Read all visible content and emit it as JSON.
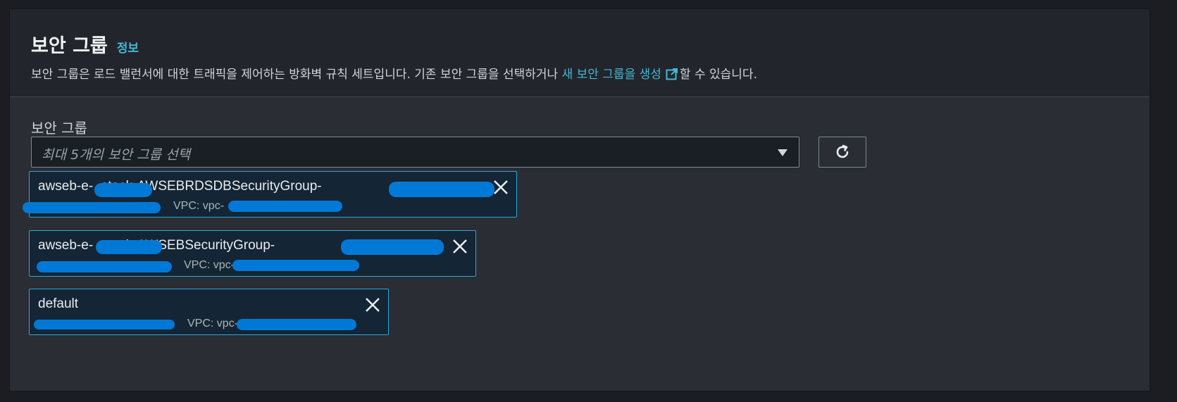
{
  "section": {
    "title": "보안 그룹",
    "info_link": "정보",
    "description_before": "보안 그룹은 로드 밸런서에 대한 트래픽을 제어하는 방화벽 규칙 세트입니다. 기존 보안 그룹을 선택하거나 ",
    "create_link": "새 보안 그룹을 생성",
    "description_after": "할 수 있습니다."
  },
  "field": {
    "label": "보안 그룹",
    "placeholder": "최대 5개의 보안 그룹 선택"
  },
  "icons": {
    "external": "external-link-icon",
    "refresh": "refresh-icon",
    "caret": "caret-down-icon",
    "dismiss": "close-icon"
  },
  "tokens": [
    {
      "name": "awseb-e-        -stack-AWSEBRDSDBSecurityGroup-",
      "vpc": "VPC: vpc-"
    },
    {
      "name": "awseb-e-        -stack-AWSEBSecurityGroup-",
      "vpc": "VPC: vpc-"
    },
    {
      "name": "default",
      "vpc": "VPC: vpc-"
    }
  ],
  "colors": {
    "accent": "#44b9d6",
    "token_border": "#2ea9d6",
    "redaction": "#0079d6"
  }
}
